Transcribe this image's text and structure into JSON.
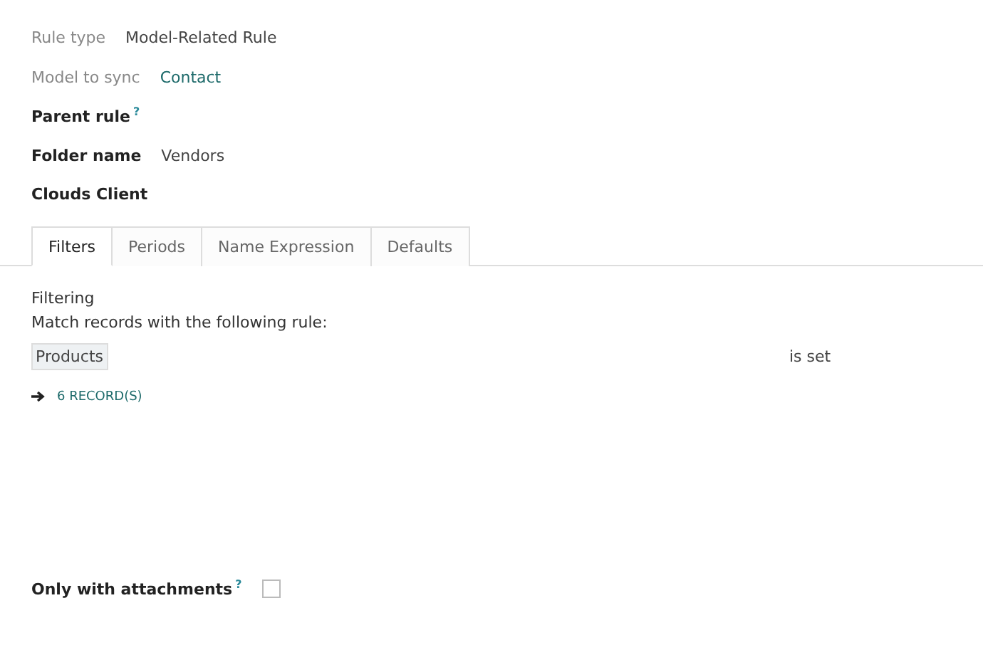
{
  "fields": [
    {
      "label": "Rule type",
      "value": "Model-Related Rule",
      "kind": "muted"
    },
    {
      "label": "Model to sync",
      "value": "Contact",
      "kind": "link"
    },
    {
      "label": "Parent rule",
      "help": "?",
      "kind": "bold"
    },
    {
      "label": "Folder name",
      "value": "Vendors",
      "kind": "bold"
    },
    {
      "label": "Clouds Client",
      "kind": "bold"
    }
  ],
  "tabs": [
    {
      "label": "Filters",
      "selected": true
    },
    {
      "label": "Periods",
      "selected": false
    },
    {
      "label": "Name Expression",
      "selected": false
    },
    {
      "label": "Defaults",
      "selected": false
    }
  ],
  "filtering": {
    "title": "Filtering",
    "description": "Match records with the following rule:",
    "rule_field": "Products",
    "rule_operator": "is set",
    "records_link": "6 RECORD(S)"
  },
  "attachments": {
    "label": "Only with attachments",
    "help": "?",
    "checked": false
  }
}
